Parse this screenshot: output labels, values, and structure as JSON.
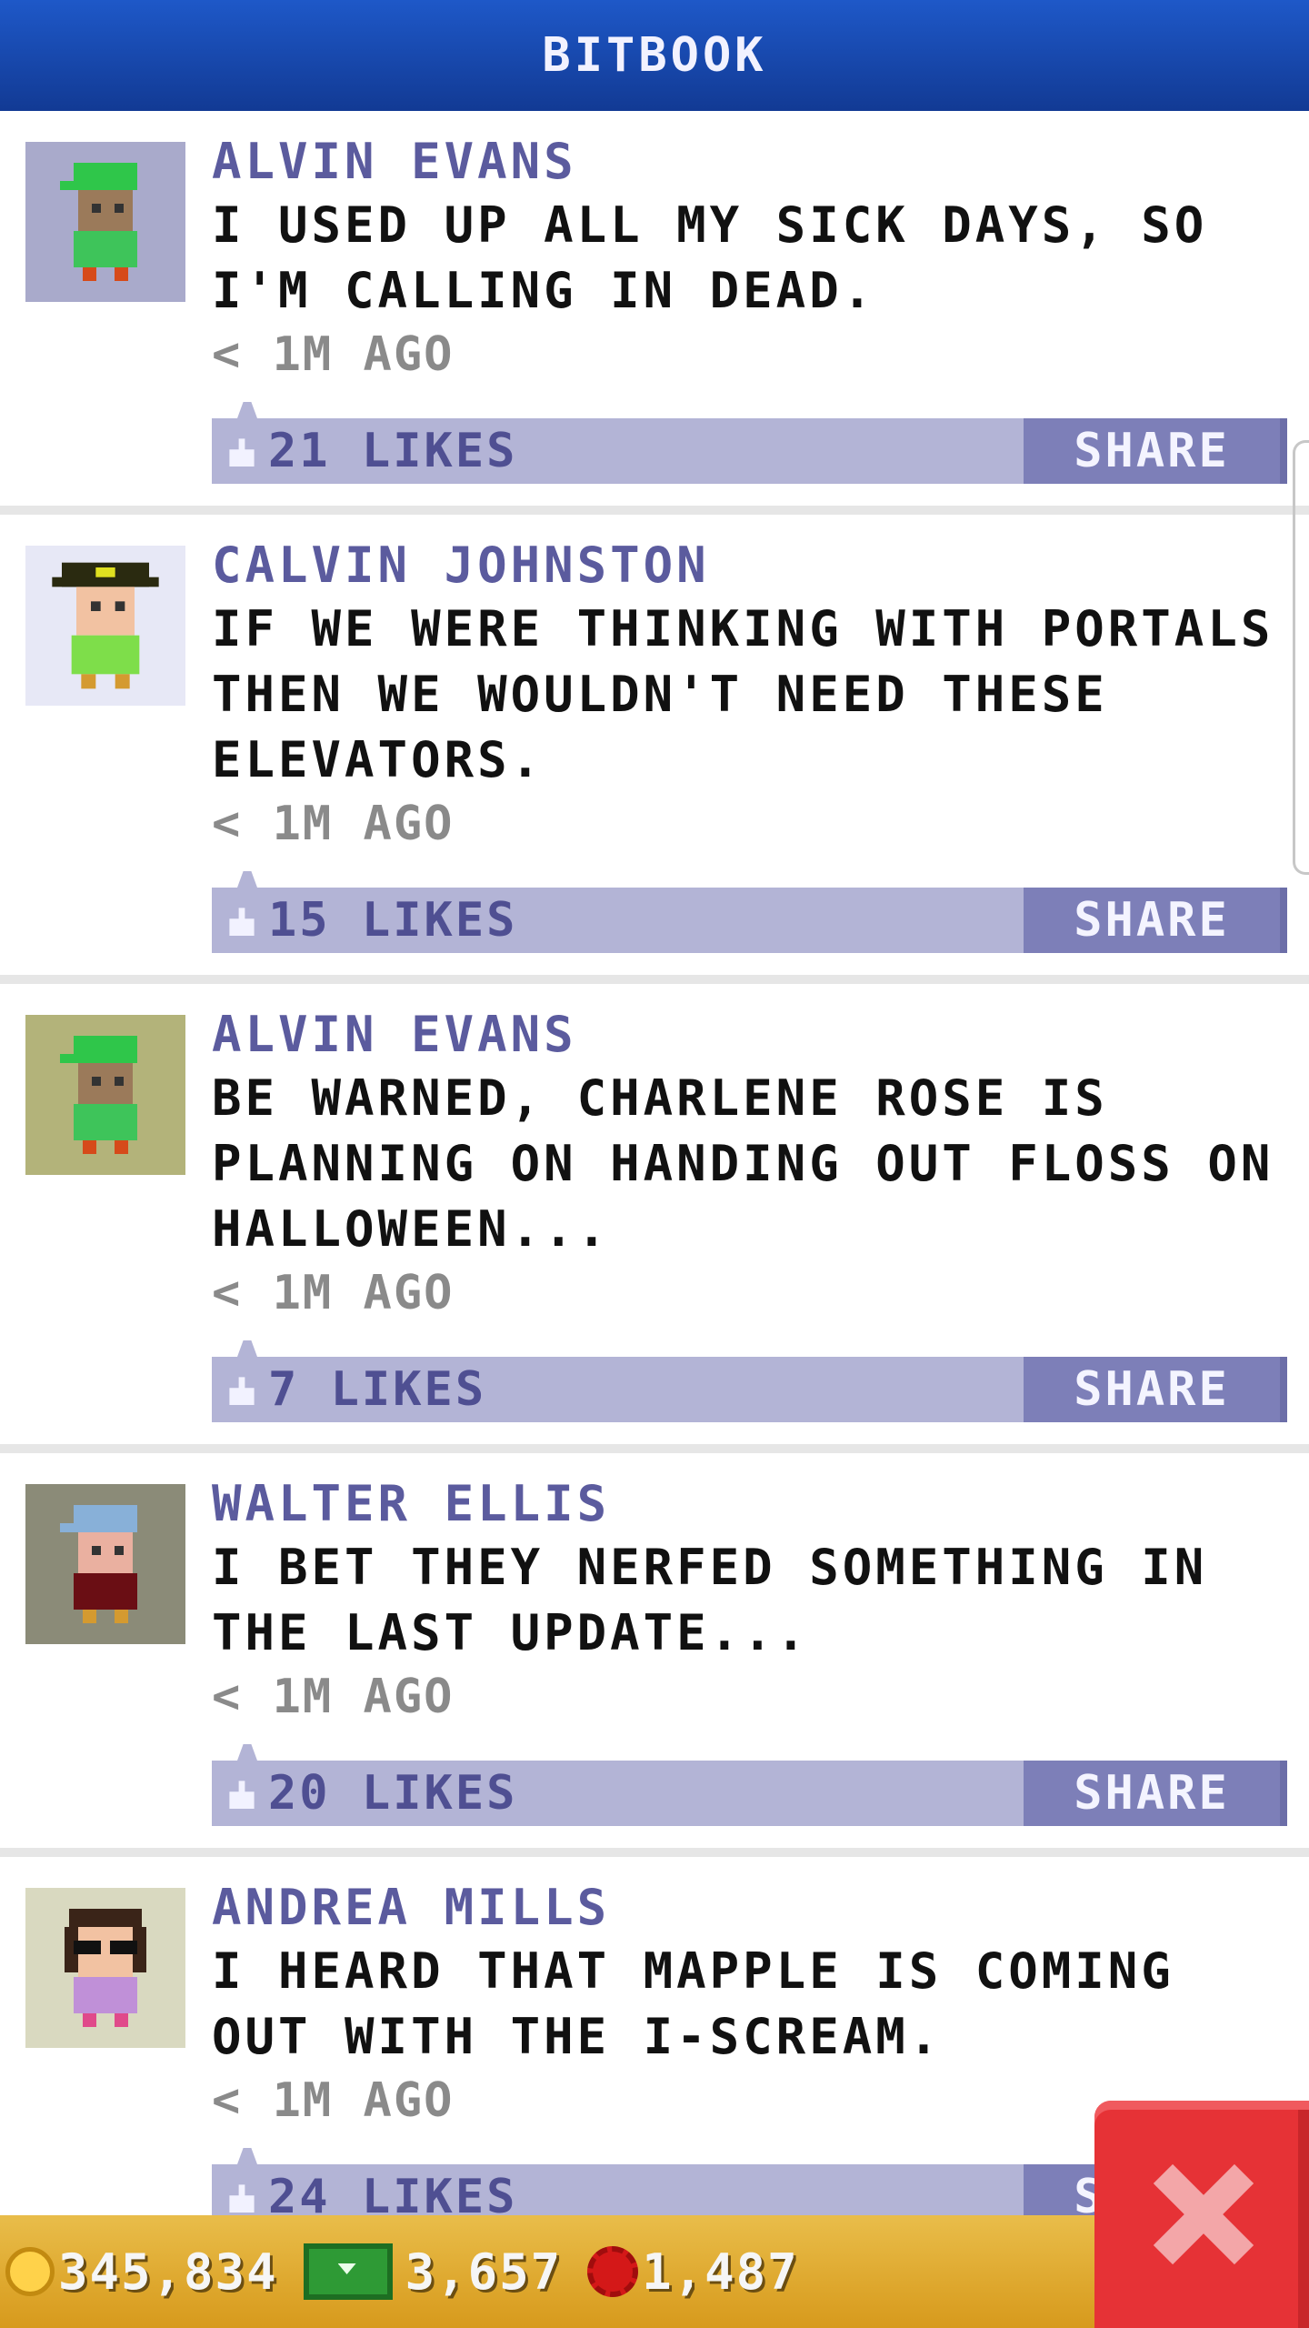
{
  "header": {
    "title": "BITBOOK"
  },
  "posts": [
    {
      "author": "ALVIN EVANS",
      "text": "I USED UP ALL MY SICK DAYS, SO I'M CALLING IN DEAD.",
      "time": "< 1M AGO",
      "likes": "21 LIKES",
      "share": "SHARE",
      "avatar_bg": "#a9aacb",
      "avatar_icon": "green-cap-avatar"
    },
    {
      "author": "CALVIN JOHNSTON",
      "text": "IF WE WERE THINKING WITH PORTALS THEN WE WOULDN'T NEED THESE ELEVATORS.",
      "time": "< 1M AGO",
      "likes": "15 LIKES",
      "share": "SHARE",
      "avatar_bg": "#e7e8f6",
      "avatar_icon": "pirate-hat-avatar"
    },
    {
      "author": "ALVIN EVANS",
      "text": "BE WARNED, CHARLENE ROSE IS PLANNING ON HANDING OUT FLOSS ON HALLOWEEN...",
      "time": "< 1M AGO",
      "likes": "7 LIKES",
      "share": "SHARE",
      "avatar_bg": "#b3b37a",
      "avatar_icon": "green-cap-avatar"
    },
    {
      "author": "WALTER ELLIS",
      "text": "I BET THEY NERFED SOMETHING IN THE LAST UPDATE...",
      "time": "< 1M AGO",
      "likes": "20 LIKES",
      "share": "SHARE",
      "avatar_bg": "#8b8b78",
      "avatar_icon": "blue-cap-avatar"
    },
    {
      "author": "ANDREA MILLS",
      "text": "I HEARD THAT MAPPLE IS COMING OUT WITH THE I-SCREAM.",
      "time": "< 1M AGO",
      "likes": "24 LIKES",
      "share": "SHARE",
      "avatar_bg": "#d9d9c0",
      "avatar_icon": "sunglasses-avatar"
    }
  ],
  "bottom_bar": {
    "coins": "345,834",
    "bux": "3,657",
    "gems": "1,487"
  },
  "colors": {
    "header_blue": "#1e58c8",
    "author_purple": "#5b5b9e",
    "action_bar": "#b3b4d6",
    "share_button": "#7d7fb8",
    "bottom_bar": "#e0aa30",
    "close_red": "#e63236"
  }
}
